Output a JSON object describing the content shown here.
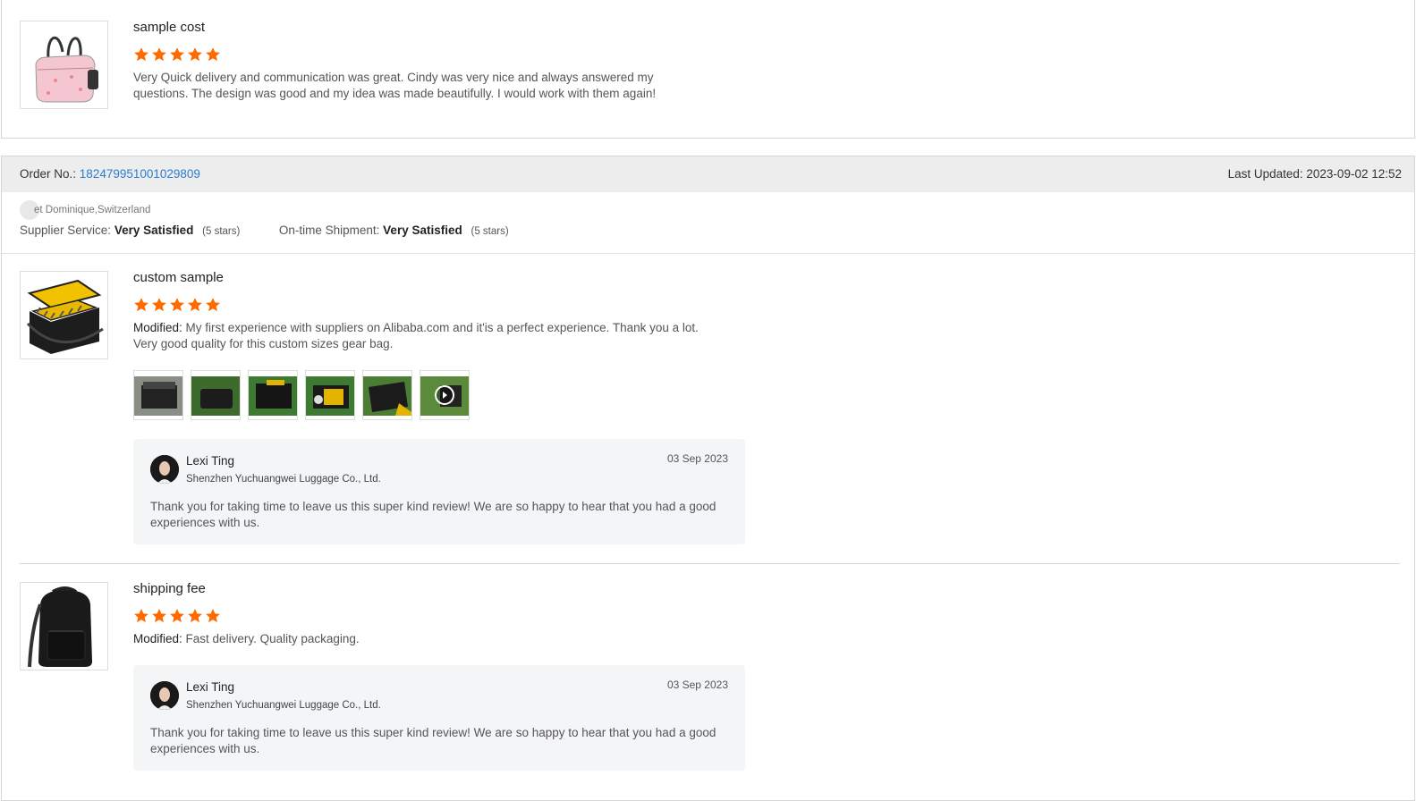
{
  "reviews_top": {
    "product_title": "sample cost",
    "rating": 5,
    "text": "Very Quick delivery and communication was great. Cindy was very nice and always answered my questions. The design was good and my idea was made beautifully. I would work with them again!"
  },
  "order": {
    "order_label": "Order No.:",
    "order_number": "182479951001029809",
    "last_updated": "Last Updated: 2023-09-02 12:52",
    "buyer": "et Dominique,Switzerland",
    "supplier_service_label": "Supplier Service:",
    "supplier_service_value": "Very Satisfied",
    "supplier_service_stars": "(5 stars)",
    "shipment_label": "On-time Shipment:",
    "shipment_value": "Very Satisfied",
    "shipment_stars": "(5 stars)",
    "items": [
      {
        "product_title": "custom sample",
        "rating": 5,
        "modified_label": "Modified:",
        "text": "My first experience with suppliers on Alibaba.com and it'is a perfect experience. Thank you a lot. Very good quality for this custom sizes gear bag.",
        "reply": {
          "name": "Lexi Ting",
          "company": "Shenzhen Yuchuangwei Luggage Co., Ltd.",
          "date": "03 Sep 2023",
          "message": "Thank you for taking time to leave us this super kind review!  We are so happy to hear that you had a good experiences with us."
        }
      },
      {
        "product_title": "shipping fee",
        "rating": 5,
        "modified_label": "Modified:",
        "text": "Fast delivery. Quality packaging.",
        "reply": {
          "name": "Lexi Ting",
          "company": "Shenzhen Yuchuangwei Luggage Co., Ltd.",
          "date": "03 Sep 2023",
          "message": "Thank you for taking time to leave us this super kind review!  We are so happy to hear that you had a good experiences with us."
        }
      }
    ]
  },
  "colors": {
    "star": "#ff6a00",
    "link": "#2b7bd0",
    "header_bg": "#ededed"
  }
}
